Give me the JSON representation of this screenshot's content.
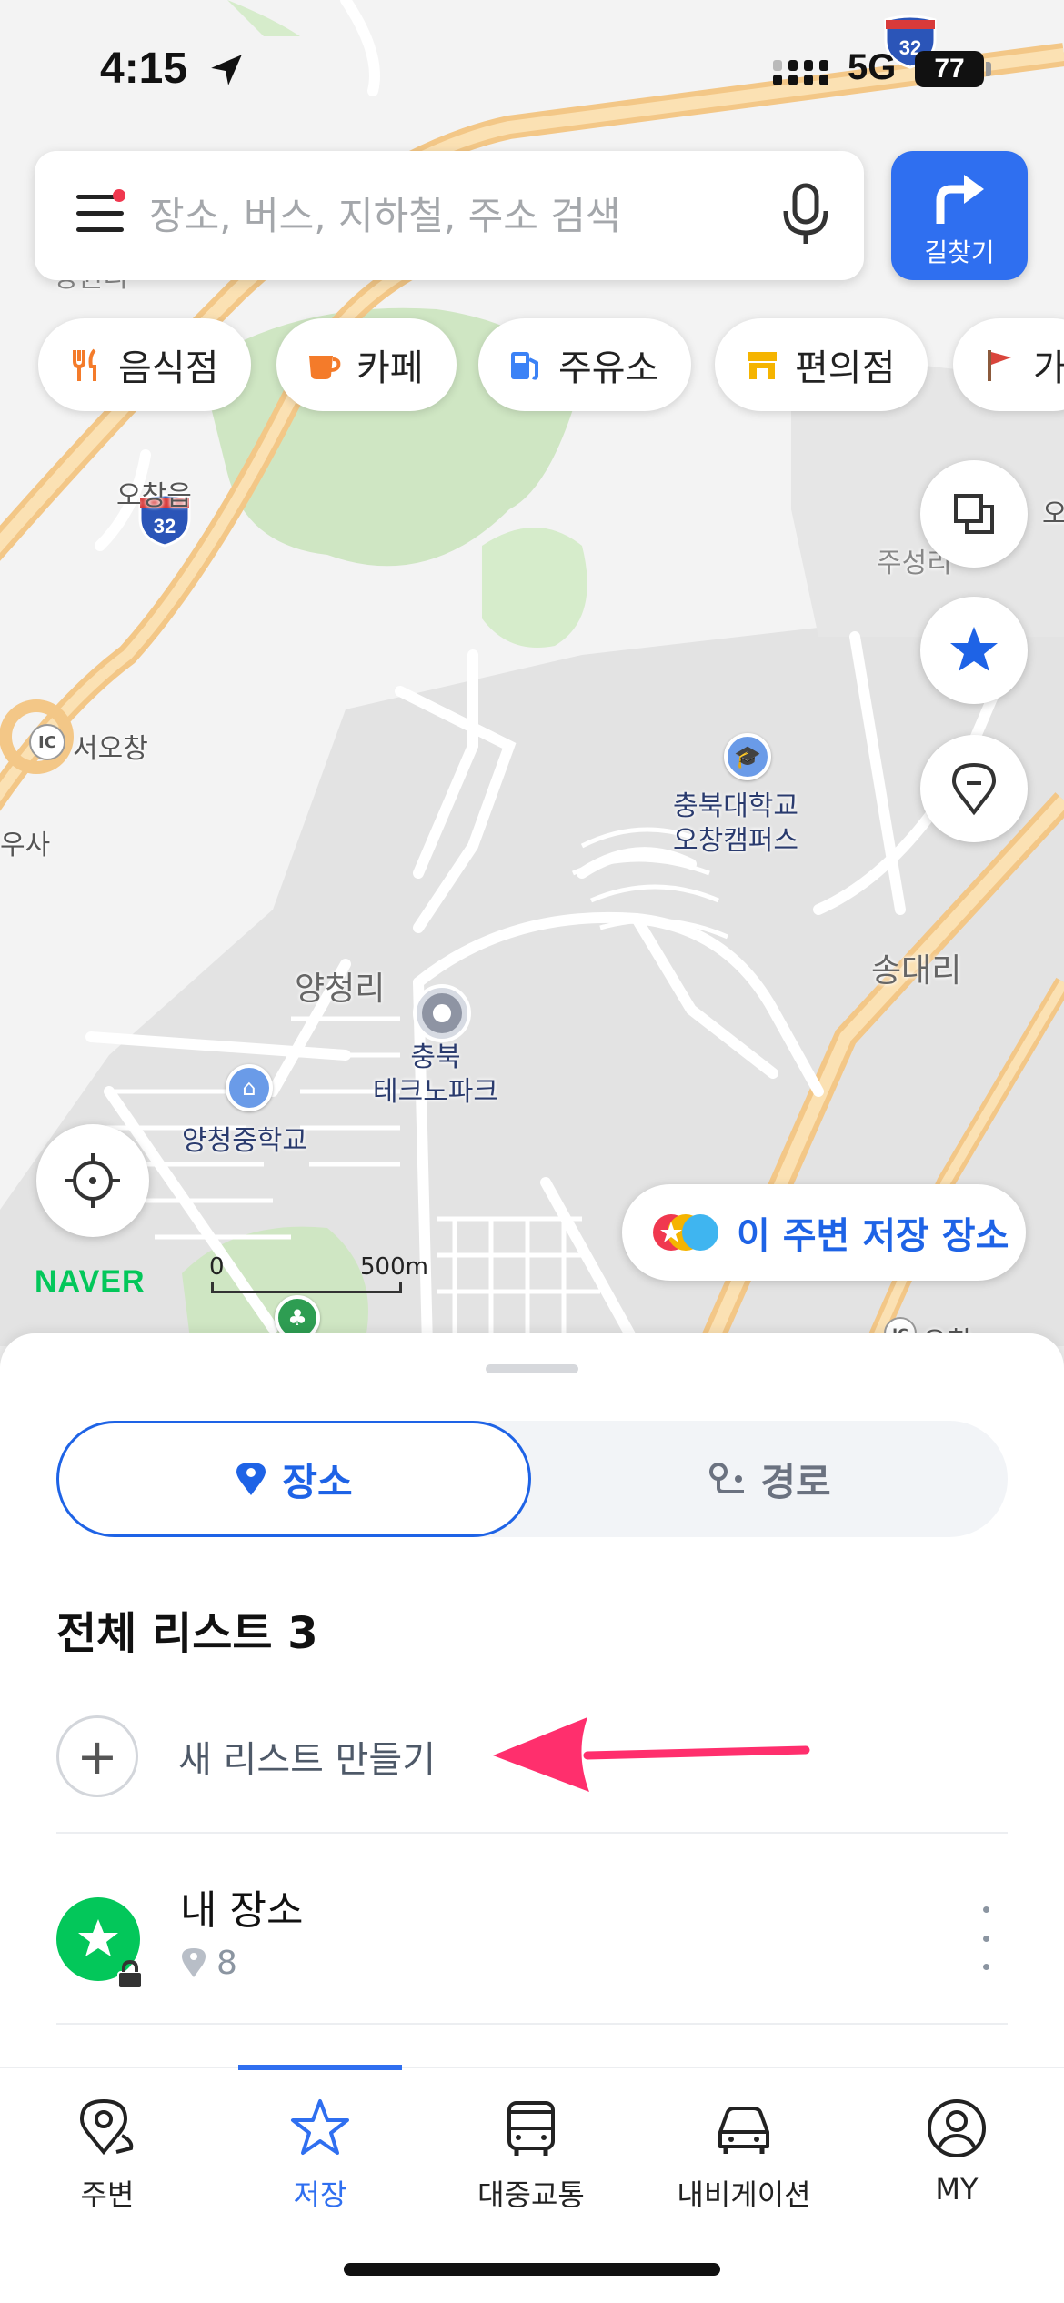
{
  "status_bar": {
    "time": "4:15",
    "network": "5G",
    "battery": "77"
  },
  "search": {
    "placeholder": "장소, 버스, 지하철, 주소 검색"
  },
  "route_button": {
    "label": "길찾기"
  },
  "categories": [
    {
      "label": "음식점",
      "icon": "fork-knife-icon",
      "color": "#f47b2a"
    },
    {
      "label": "카페",
      "icon": "coffee-cup-icon",
      "color": "#f47b2a"
    },
    {
      "label": "주유소",
      "icon": "gas-pump-icon",
      "color": "#3b82f6"
    },
    {
      "label": "편의점",
      "icon": "store-icon",
      "color": "#f5b400"
    },
    {
      "label": "가",
      "icon": "flag-icon",
      "color": "#8b5a3c"
    }
  ],
  "map": {
    "labels": {
      "seoocheon_ic": "서오창",
      "ic_badge": "IC",
      "ocheon_eup": "오창읍",
      "ocheon_ic": "오창",
      "usa": "우사",
      "jusong": "주성리",
      "songdae": "송대리",
      "yangcheong": "양청리",
      "top_left_partial": "청원리",
      "right_edge": "오"
    },
    "pois": {
      "university": "충북대학교\n오창캠퍼스",
      "technopark": "충북\n테크노파크",
      "middle_school": "양청중학교"
    },
    "highway_number": "32",
    "brand": "NAVER",
    "scale_zero": "0",
    "scale_distance": "500m",
    "nearby_saved_label": "이 주변 저장 장소"
  },
  "sheet": {
    "tabs": {
      "place": "장소",
      "route": "경로"
    },
    "list_title": "전체 리스트 3",
    "new_list_label": "새 리스트 만들기",
    "lists": [
      {
        "name": "내 장소",
        "count": "8"
      }
    ]
  },
  "tab_bar": {
    "items": [
      {
        "label": "주변",
        "icon": "nearby-pin-icon",
        "active": false
      },
      {
        "label": "저장",
        "icon": "star-icon",
        "active": true
      },
      {
        "label": "대중교통",
        "icon": "bus-icon",
        "active": false
      },
      {
        "label": "내비게이션",
        "icon": "car-icon",
        "active": false
      },
      {
        "label": "MY",
        "icon": "profile-icon",
        "active": false
      }
    ]
  },
  "colors": {
    "accent": "#2f6ff0",
    "naver_green": "#03c75a",
    "annotation": "#ff2f6d"
  }
}
